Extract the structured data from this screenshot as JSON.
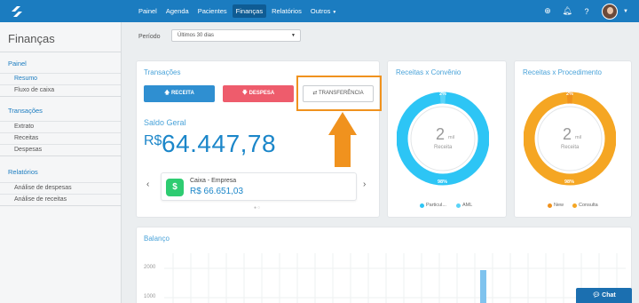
{
  "nav": {
    "items": [
      "Painel",
      "Agenda",
      "Pacientes",
      "Finanças",
      "Relatórios",
      "Outros"
    ],
    "active": "Finanças",
    "right_icons": [
      "plus-circle-icon",
      "bell-icon",
      "help-icon",
      "avatar",
      "chevron-down-icon"
    ]
  },
  "sidebar": {
    "title": "Finanças",
    "sections": [
      {
        "label": "Painel",
        "items": [
          "Resumo",
          "Fluxo de caixa"
        ]
      },
      {
        "label": "Transações",
        "items": [
          "Extrato",
          "Receitas",
          "Despesas"
        ]
      },
      {
        "label": "Relatórios",
        "items": [
          "Análise de despesas",
          "Análise de receitas"
        ]
      }
    ],
    "active_item": "Resumo"
  },
  "period": {
    "label": "Período",
    "value": "Últimos 30 dias"
  },
  "transacoes": {
    "title": "Transações",
    "btn_receita": "RECEITA",
    "btn_despesa": "DESPESA",
    "btn_transferencia": "TRANSFERÊNCIA",
    "saldo_label": "Saldo Geral",
    "saldo_currency": "R$",
    "saldo_value": "64.447,78",
    "account": {
      "name": "Caixa - Empresa",
      "value": "R$ 66.651,03"
    },
    "carousel_pages": 2
  },
  "receitas_convenio": {
    "title": "Receitas x Convênio",
    "center_value": "2",
    "center_unit": "mil",
    "center_label": "Receita",
    "slices": [
      {
        "label": "Particul...",
        "pct": "98%",
        "value": 98,
        "color": "#2dc5f5"
      },
      {
        "label": "AML",
        "pct": "2%",
        "value": 2,
        "color": "#5bd3f7"
      }
    ]
  },
  "receitas_procedimento": {
    "title": "Receitas x Procedimento",
    "center_value": "2",
    "center_unit": "mil",
    "center_label": "Receita",
    "slices": [
      {
        "label": "New",
        "pct": "2%",
        "value": 2,
        "color": "#f0921e"
      },
      {
        "label": "Consulta",
        "pct": "98%",
        "value": 98,
        "color": "#f5a623"
      }
    ]
  },
  "balanco": {
    "title": "Balanço",
    "y_ticks": [
      "2000",
      "1000"
    ]
  },
  "chat": {
    "label": "Chat"
  }
}
